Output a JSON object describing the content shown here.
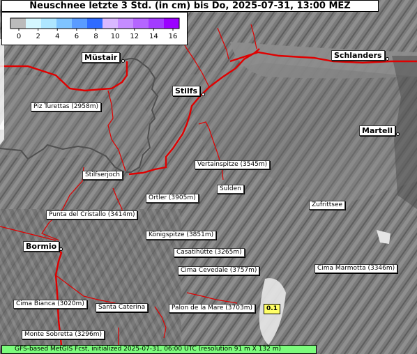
{
  "title": "Neuschnee letzte 3 Std. (in cm) bis Do, 2025-07-31, 13:00 MEZ",
  "legend": {
    "colors": [
      "#bbbbbb",
      "#d4f7ff",
      "#aee6ff",
      "#7fc4ff",
      "#5a9cff",
      "#2f6bff",
      "#d9b8ff",
      "#c58cff",
      "#b565ff",
      "#a33bff",
      "#9b00ff"
    ],
    "ticks": [
      "0",
      "2",
      "4",
      "6",
      "8",
      "10",
      "12",
      "14",
      "16"
    ]
  },
  "places": {
    "mustair": "Müstair",
    "schlanders": "Schlanders",
    "stilfs": "Stilfs",
    "martell": "Martell",
    "bormio": "Bormio"
  },
  "peaks": {
    "piz_turettas": "Piz Turettas (2958m)",
    "vertainspitze": "Vertainspitze (3545m)",
    "stilfserjoch": "Stilfserjoch",
    "sulden": "Sulden",
    "ortler": "Ortler (3905m)",
    "zufrittsee": "Zufrittsee",
    "punta_cristallo": "Punta del Cristallo (3414m)",
    "konigspitze": "Königspitze (3851m)",
    "casatihutte": "Casatihütte (3265m)",
    "cima_cevedale": "Cima Cevedale (3757m)",
    "cima_marmotta": "Cima Marmotta (3346m)",
    "cima_bianca": "Cima Bianca (3020m)",
    "santa_caterina": "Santa Caterina",
    "palon_de_la_mare": "Palon de la Mare (3703m)",
    "monte_sobretta": "Monte Sobretta (3296m)"
  },
  "value_label": "0.1",
  "footer": "GFS-based MetGIS Fcst, initialized 2025-07-31, 06:00 UTC  (resolution 91 m X 132 m)"
}
